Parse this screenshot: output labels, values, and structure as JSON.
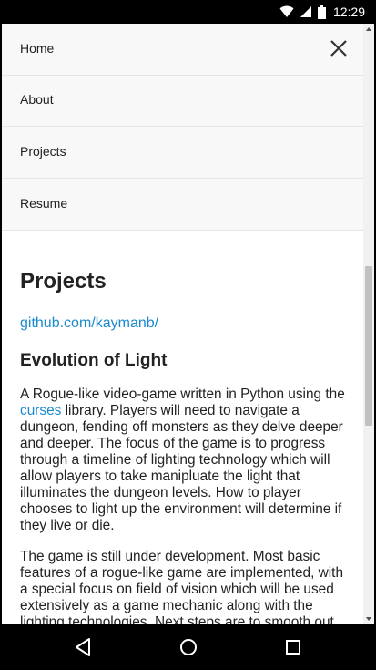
{
  "status_bar": {
    "time": "12:29",
    "icons": [
      "wifi-icon",
      "signal-icon",
      "battery-icon"
    ]
  },
  "nav_menu": {
    "items": [
      {
        "label": "Home"
      },
      {
        "label": "About"
      },
      {
        "label": "Projects"
      },
      {
        "label": "Resume"
      }
    ],
    "close_icon": "close-icon"
  },
  "content": {
    "page_title": "Projects",
    "github_link": "github.com/kaymanb/",
    "section_title": "Evolution of Light",
    "para1": {
      "before_link": "A Rogue-like video-game written in Python using the ",
      "link": "curses",
      "after_link": " library. Players will need to navigate a dungeon, fending off monsters as they delve deeper and deeper. The focus of the game is to progress through a timeline of lighting technology which will allow players to take manipluate the light that illuminates the dungeon levels. How to player chooses to light up the environment will determine if they live or die."
    },
    "para2": "The game is still under development. Most basic features of a rogue-like game are implemented, with a special focus on field of vision which will be used extensively as a game mechanic along with the lighting technologies. Next steps are to smooth out NPC combat, as well as some basic"
  },
  "android_nav": {
    "icons": [
      "back-icon",
      "home-icon",
      "recents-icon"
    ]
  },
  "colors": {
    "link": "#1a8ad0",
    "nav_background": "#f8f8f8",
    "text": "#222222"
  }
}
